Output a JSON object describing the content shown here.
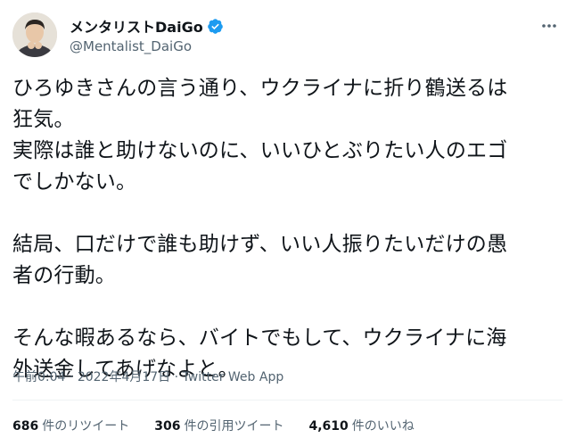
{
  "tweet": {
    "author": {
      "display_name": "メンタリストDaiGo",
      "handle": "@Mentalist_DaiGo"
    },
    "paragraphs": [
      [
        "ひろゆきさんの言う通り、ウクライナに折り鶴送るは",
        "狂気。",
        "実際は誰と助けないのに、いいひとぶりたい人のエゴ",
        "でしかない。"
      ],
      [
        "結局、口だけで誰も助けず、いい人振りたいだけの愚",
        "者の行動。"
      ],
      [
        "そんな暇あるなら、バイトでもして、ウクライナに海",
        "外送金してあげなよと。"
      ]
    ],
    "time": "午前0:04",
    "date": "2022年4月17日",
    "source": "Twitter Web App",
    "stats": {
      "retweets_count": "686",
      "retweets_label": "件のリツイート",
      "quotes_count": "306",
      "quotes_label": "件の引用ツイート",
      "likes_count": "4,610",
      "likes_label": "件のいいね"
    }
  },
  "icons": {
    "verified": "verified-badge-icon",
    "more": "more-dots-icon"
  },
  "colors": {
    "text_primary": "#0f1419",
    "text_secondary": "#536471",
    "verified_blue": "#1d9bf0",
    "divider": "#eff3f4"
  }
}
